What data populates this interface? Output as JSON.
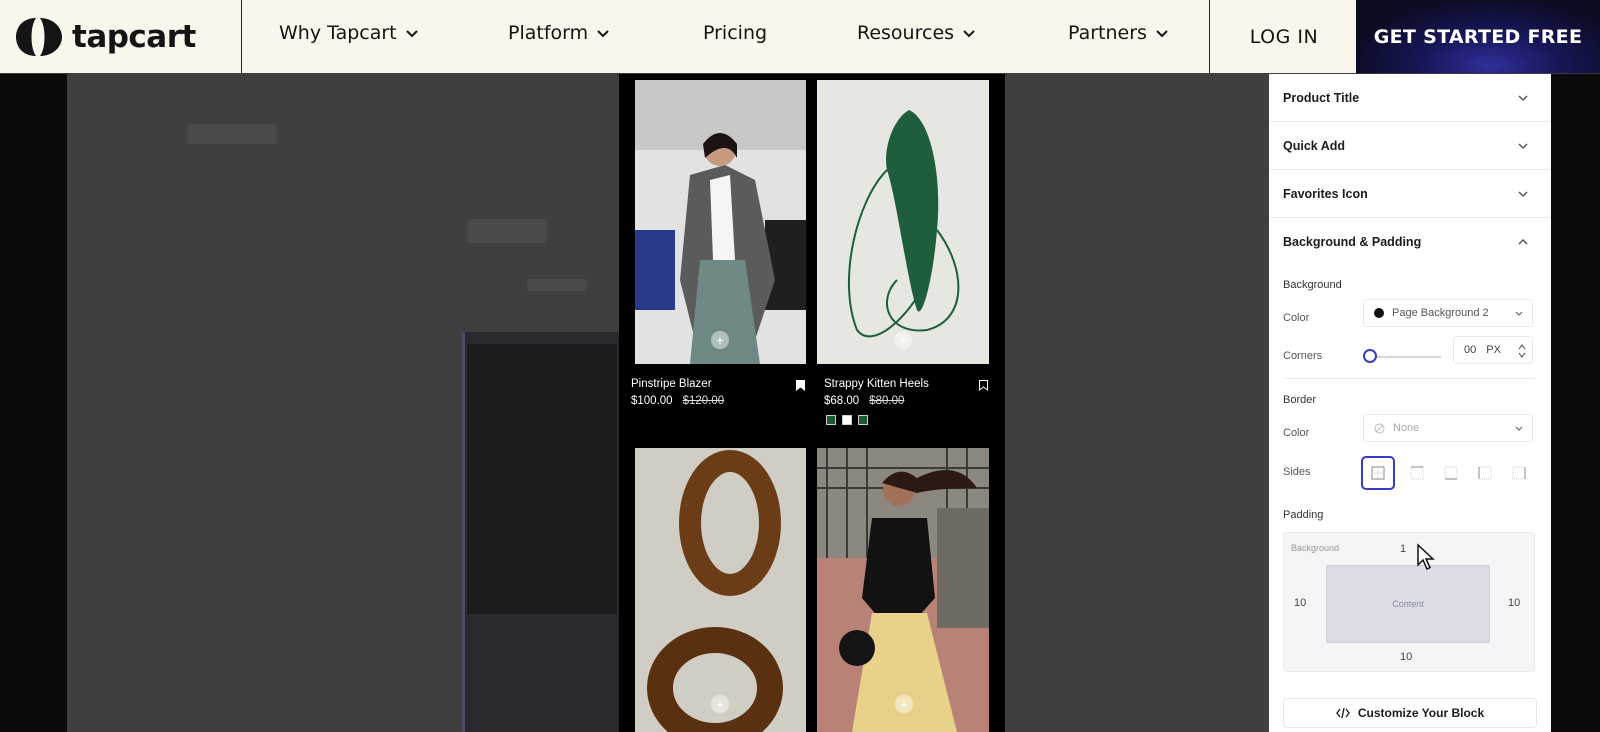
{
  "brand": {
    "name": "tapcart"
  },
  "nav": {
    "items": [
      {
        "label": "Why Tapcart",
        "dropdown": true
      },
      {
        "label": "Platform",
        "dropdown": true
      },
      {
        "label": "Pricing",
        "dropdown": false
      },
      {
        "label": "Resources",
        "dropdown": true
      },
      {
        "label": "Partners",
        "dropdown": true
      }
    ],
    "login": "LOG IN",
    "cta": "GET STARTED FREE"
  },
  "products": [
    {
      "name": "Pinstripe Blazer",
      "price": "$100.00",
      "old_price": "$120.00",
      "bookmarked": true
    },
    {
      "name": "Strappy Kitten Heels",
      "price": "$68.00",
      "old_price": "$80.00",
      "bookmarked": false,
      "swatches": [
        "#1f5a35",
        "#ffffff",
        "#1f5a35"
      ]
    }
  ],
  "panel": {
    "sections": [
      "Product Title",
      "Quick Add",
      "Favorites Icon"
    ],
    "open_section": "Background & Padding",
    "background": {
      "heading": "Background",
      "color_label": "Color",
      "color_value": "Page Background 2",
      "corners_label": "Corners",
      "corners_value": "00",
      "corners_unit": "PX"
    },
    "border": {
      "heading": "Border",
      "color_label": "Color",
      "color_value": "None",
      "sides_label": "Sides"
    },
    "padding": {
      "heading": "Padding",
      "box_label": "Background",
      "top": "1",
      "left": "10",
      "right": "10",
      "bottom": "10",
      "content_label": "Content"
    },
    "customize_button": "Customize Your Block"
  },
  "colors": {
    "accent": "#3a3ac8",
    "nav_bg": "#faf6ec"
  }
}
